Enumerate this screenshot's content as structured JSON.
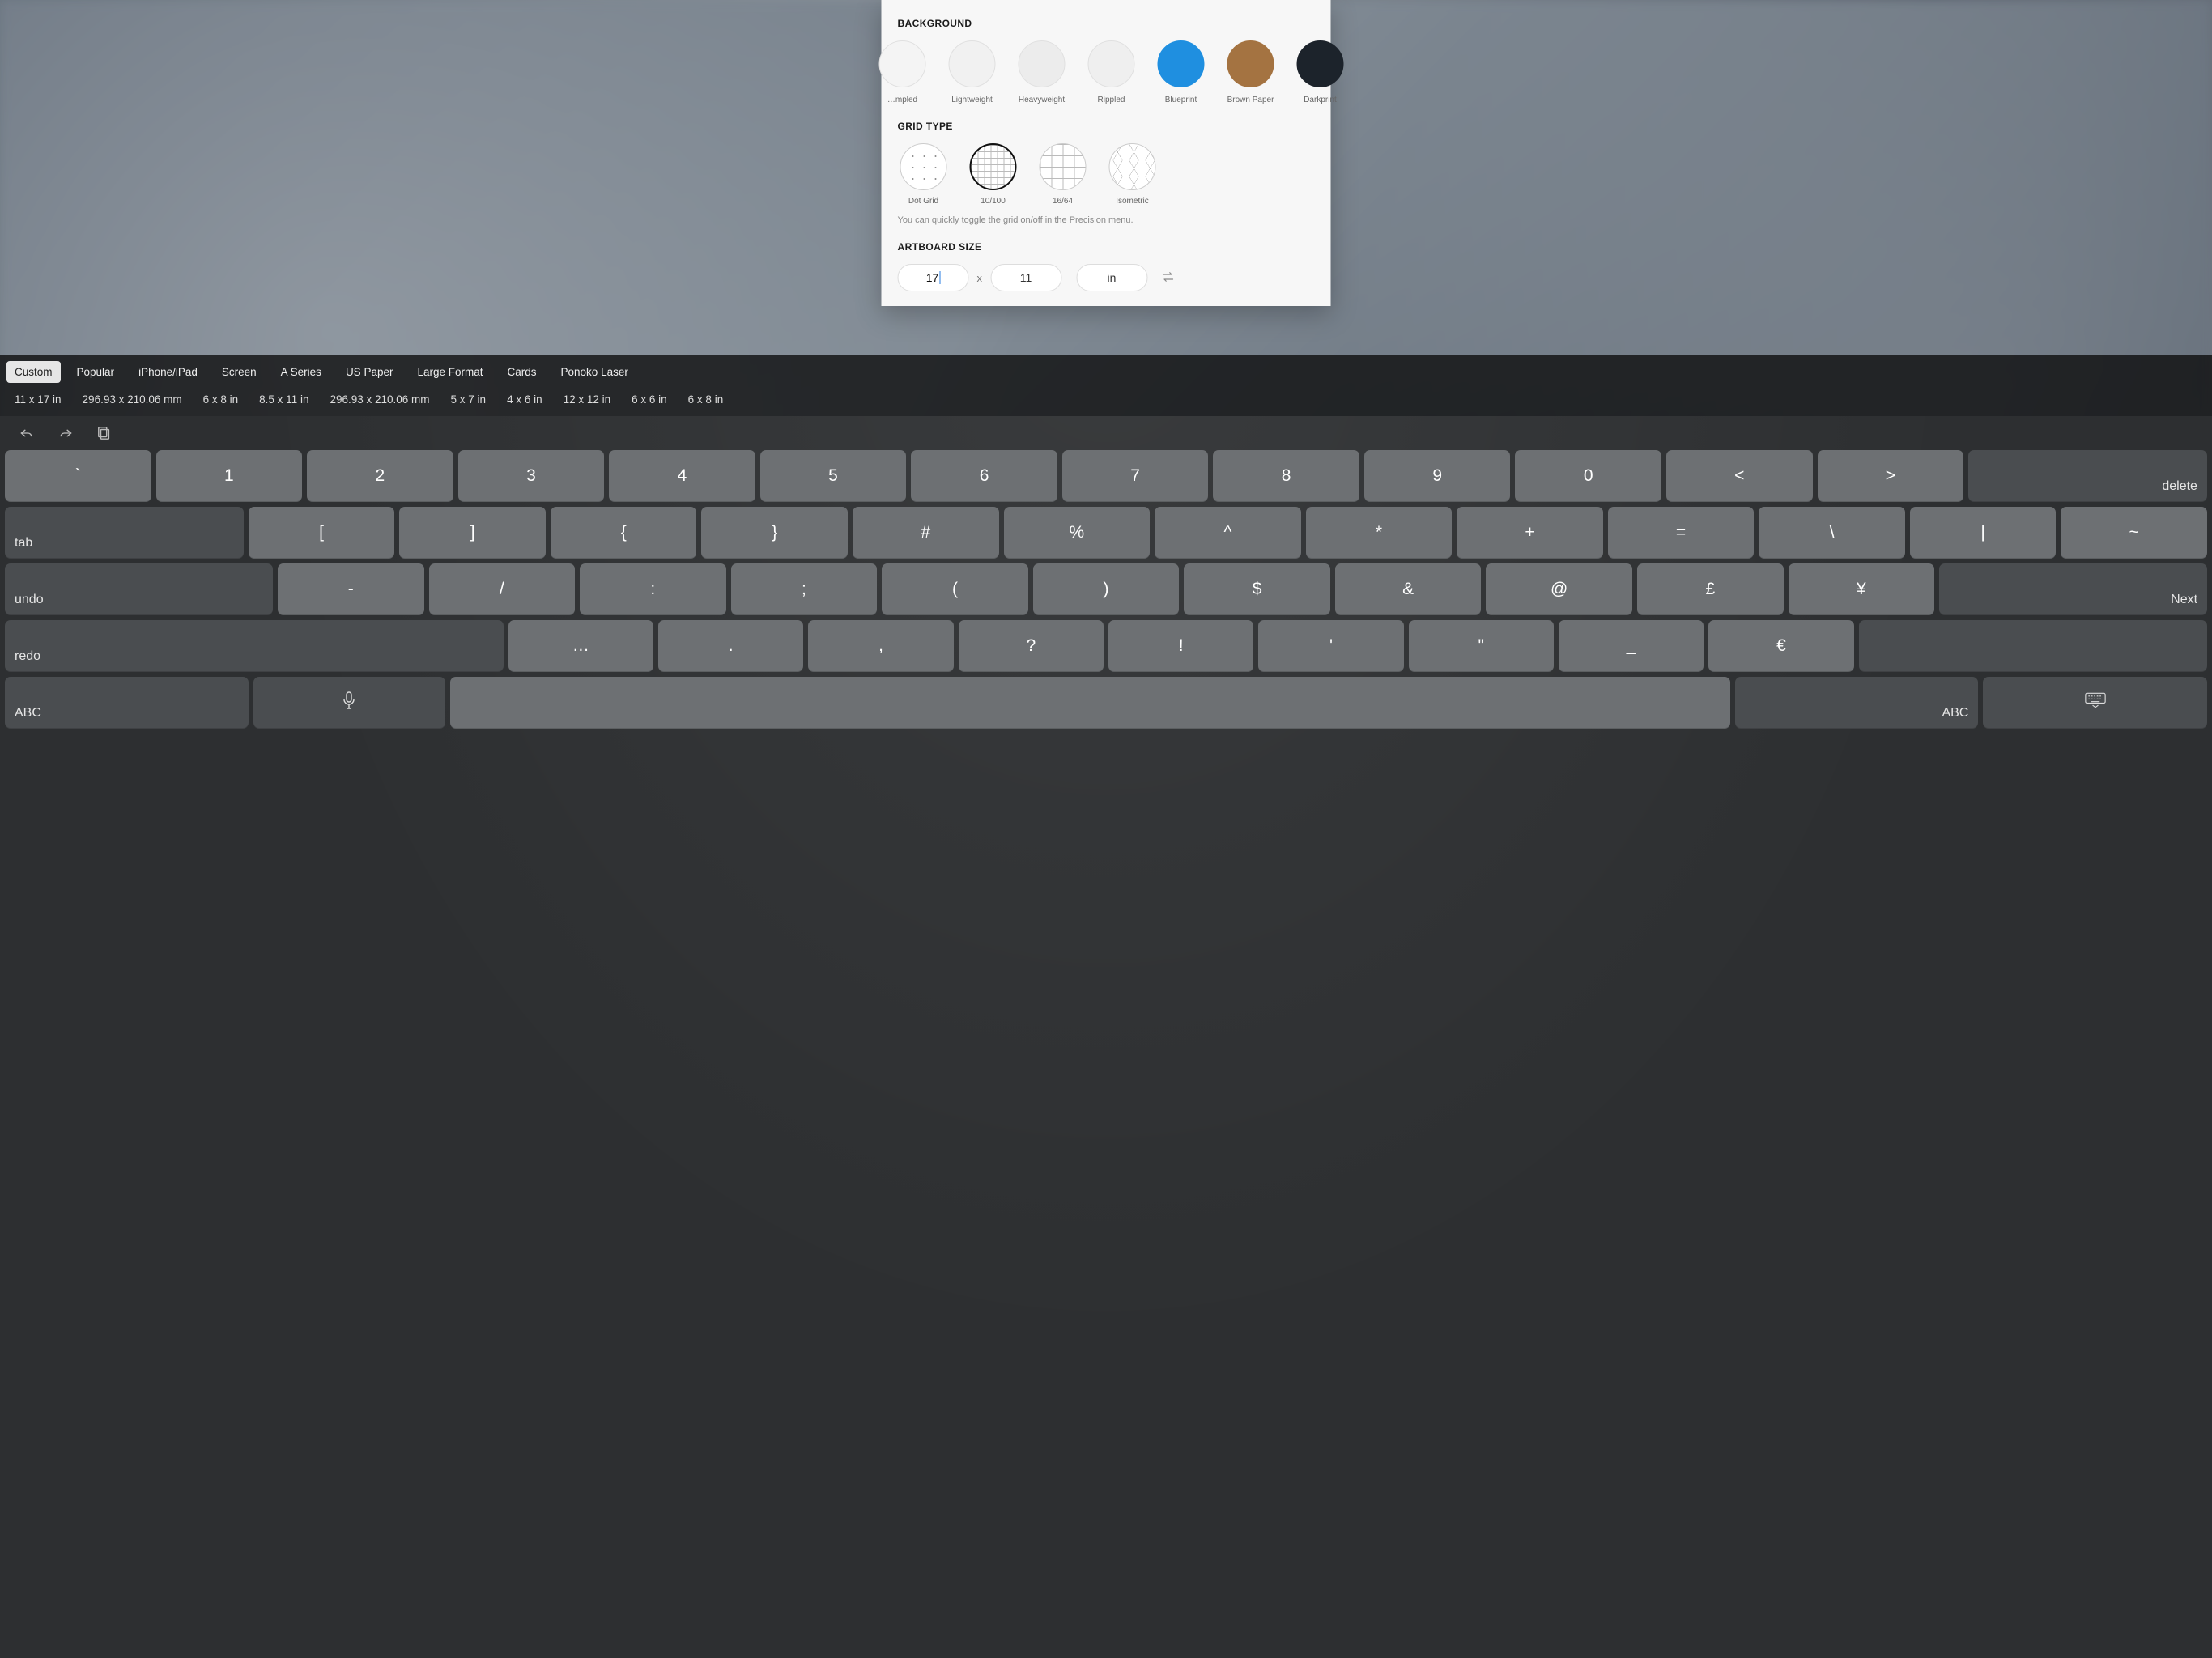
{
  "sections": {
    "background": {
      "title": "BACKGROUND",
      "items": [
        {
          "label": "…mpled",
          "color": "#f4f4f4"
        },
        {
          "label": "Lightweight",
          "color": "#f1f1f1"
        },
        {
          "label": "Heavyweight",
          "color": "#ececec"
        },
        {
          "label": "Rippled",
          "color": "#efefef"
        },
        {
          "label": "Blueprint",
          "color": "#1f8fe0"
        },
        {
          "label": "Brown Paper",
          "color": "#a47341"
        },
        {
          "label": "Darkprint",
          "color": "#1c232b"
        }
      ]
    },
    "grid": {
      "title": "GRID TYPE",
      "items": [
        {
          "label": "Dot Grid"
        },
        {
          "label": "10/100",
          "selected": true
        },
        {
          "label": "16/64"
        },
        {
          "label": "Isometric"
        }
      ],
      "hint": "You can quickly toggle the grid on/off in the Precision menu."
    },
    "artboard": {
      "title": "ARTBOARD SIZE",
      "width": "17",
      "height": "11",
      "unit": "in",
      "x": "x"
    }
  },
  "presets": {
    "categories": [
      "Custom",
      "Popular",
      "iPhone/iPad",
      "Screen",
      "A Series",
      "US Paper",
      "Large Format",
      "Cards",
      "Ponoko Laser"
    ],
    "selected": "Custom",
    "dims": [
      "11 x 17 in",
      "296.93 x 210.06 mm",
      "6 x 8 in",
      "8.5 x 11 in",
      "296.93 x 210.06 mm",
      "5 x 7 in",
      "4 x 6 in",
      "12 x 12 in",
      "6 x 6 in",
      "6 x 8 in"
    ]
  },
  "keyboard": {
    "row1": [
      "`",
      "1",
      "2",
      "3",
      "4",
      "5",
      "6",
      "7",
      "8",
      "9",
      "0",
      "<",
      ">"
    ],
    "delete": "delete",
    "tab": "tab",
    "row2": [
      "[",
      "]",
      "{",
      "}",
      "#",
      "%",
      "^",
      "*",
      "+",
      "=",
      "\\",
      "|",
      "~"
    ],
    "undo": "undo",
    "row3": [
      "-",
      "/",
      ":",
      ";",
      "(",
      ")",
      "$",
      "&",
      "@",
      "£",
      "¥"
    ],
    "next": "Next",
    "redo": "redo",
    "row4": [
      "…",
      ".",
      ",",
      "?",
      "!",
      "'",
      "\"",
      "_",
      "€"
    ],
    "abc": "ABC"
  }
}
